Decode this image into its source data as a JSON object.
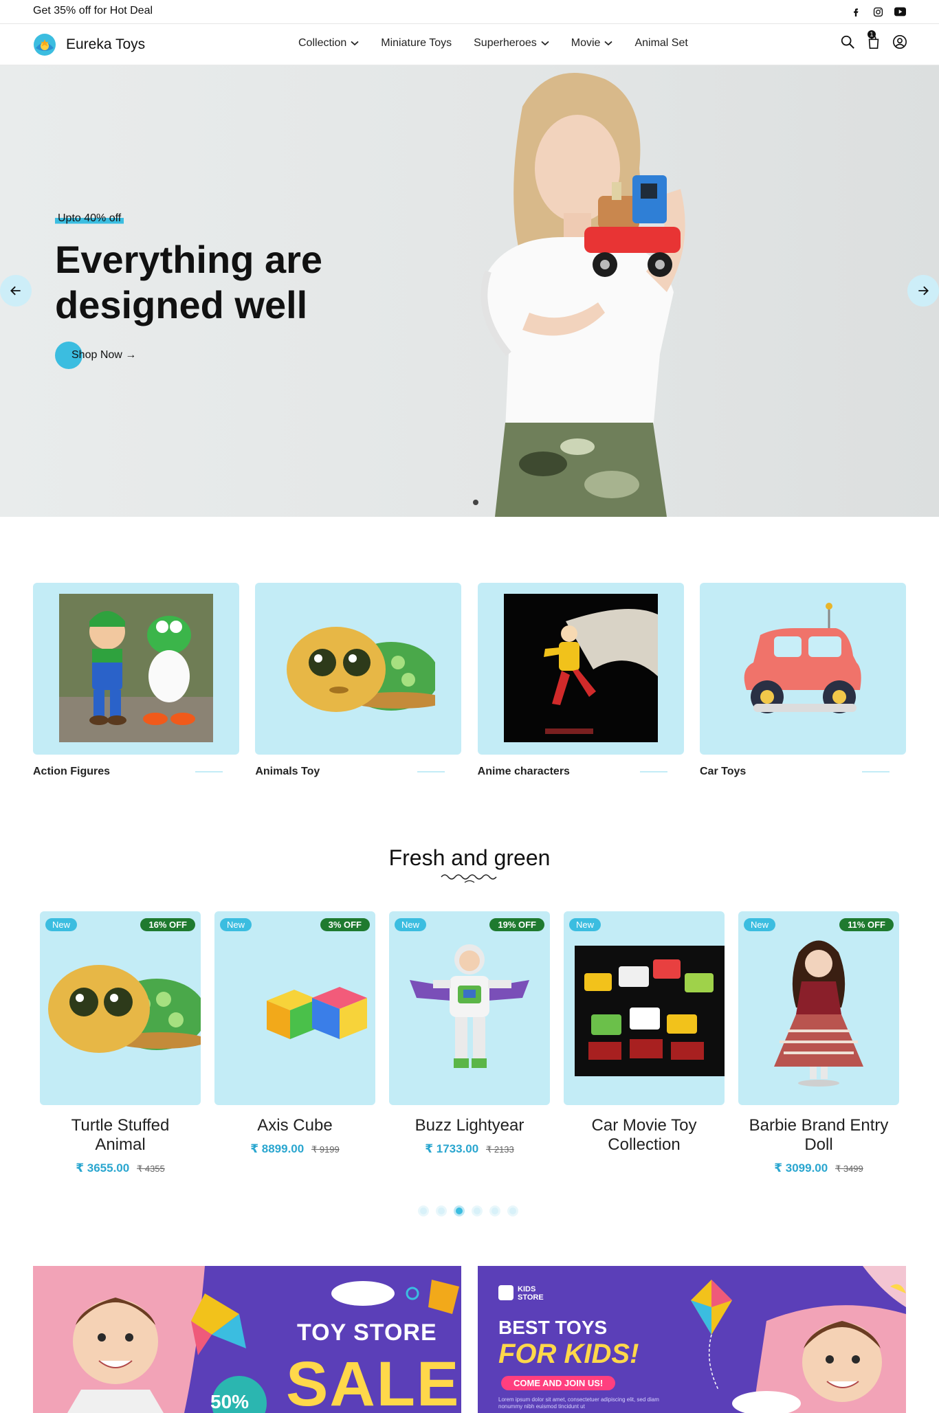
{
  "topbar": {
    "deal_text": "Get 35% off for Hot Deal",
    "social": [
      "facebook-icon",
      "instagram-icon",
      "youtube-icon"
    ]
  },
  "header": {
    "brand": "Eureka Toys",
    "nav": [
      {
        "label": "Collection",
        "dropdown": true
      },
      {
        "label": "Miniature Toys",
        "dropdown": false
      },
      {
        "label": "Superheroes",
        "dropdown": true
      },
      {
        "label": "Movie",
        "dropdown": true
      },
      {
        "label": "Animal Set",
        "dropdown": false
      }
    ],
    "cart_count": "1",
    "icons": [
      "search-icon",
      "cart-icon",
      "user-icon"
    ]
  },
  "hero": {
    "eyebrow": "Upto 40% off",
    "headline": "Everything are designed well",
    "cta": "Shop Now →"
  },
  "categories": [
    {
      "label": "Action Figures"
    },
    {
      "label": "Animals Toy"
    },
    {
      "label": "Anime characters"
    },
    {
      "label": "Car Toys"
    }
  ],
  "products_section": {
    "title": "Fresh and green",
    "items": [
      {
        "name": "Turtle Stuffed Animal",
        "badge": "New",
        "discount": "16% OFF",
        "price": "₹ 3655.00",
        "old_price": "₹ 4355"
      },
      {
        "name": "Axis Cube",
        "badge": "New",
        "discount": "3% OFF",
        "price": "₹ 8899.00",
        "old_price": "₹ 9199"
      },
      {
        "name": "Buzz Lightyear",
        "badge": "New",
        "discount": "19% OFF",
        "price": "₹ 1733.00",
        "old_price": "₹ 2133"
      },
      {
        "name": "Car Movie Toy Collection",
        "badge": "New",
        "discount": "",
        "price": "",
        "old_price": ""
      },
      {
        "name": "Barbie Brand Entry Doll",
        "badge": "New",
        "discount": "11% OFF",
        "price": "₹ 3099.00",
        "old_price": "₹ 3499"
      }
    ],
    "carousel_active": 3,
    "carousel_total": 6
  },
  "banners": {
    "left": {
      "line1": "TOY STORE",
      "line2": "SALE",
      "percent": "50%"
    },
    "right": {
      "kids_store": "KIDS STORE",
      "line1": "BEST TOYS",
      "line2": "FOR KIDS!",
      "pill": "COME AND JOIN US!",
      "small": "Lorem ipsum dolor sit amet, consectetuer adipiscing elit, sed diam nonummy nibh euismod tincidunt ut"
    }
  },
  "colors": {
    "accent": "#3bbde0",
    "tile": "#c3ecf6",
    "discount": "#1f7a2f",
    "price": "#2aa6cf"
  }
}
